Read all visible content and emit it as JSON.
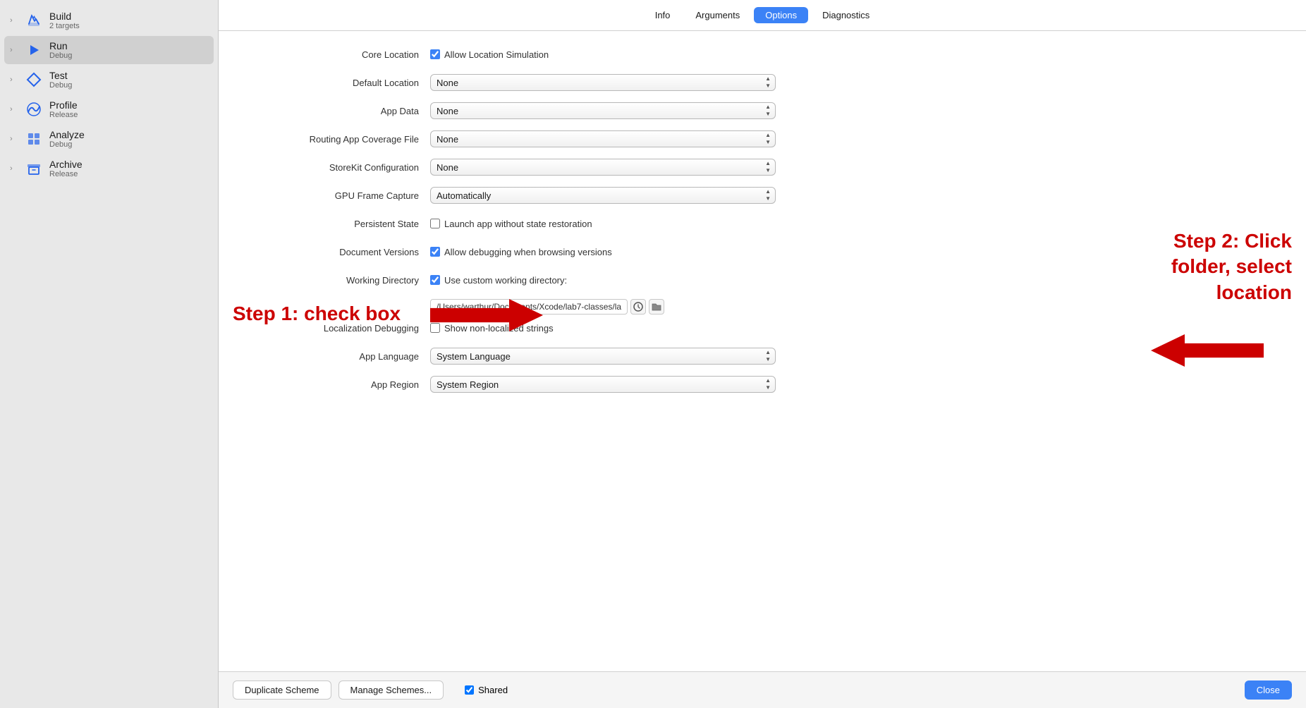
{
  "sidebar": {
    "items": [
      {
        "id": "build",
        "label": "Build",
        "sublabel": "2 targets",
        "icon": "hammer",
        "selected": false
      },
      {
        "id": "run",
        "label": "Run",
        "sublabel": "Debug",
        "icon": "play",
        "selected": true
      },
      {
        "id": "test",
        "label": "Test",
        "sublabel": "Debug",
        "icon": "diamond",
        "selected": false
      },
      {
        "id": "profile",
        "label": "Profile",
        "sublabel": "Release",
        "icon": "wave",
        "selected": false
      },
      {
        "id": "analyze",
        "label": "Analyze",
        "sublabel": "Debug",
        "icon": "grid",
        "selected": false
      },
      {
        "id": "archive",
        "label": "Archive",
        "sublabel": "Release",
        "icon": "box",
        "selected": false
      }
    ]
  },
  "tabs": {
    "items": [
      "Info",
      "Arguments",
      "Options",
      "Diagnostics"
    ],
    "active": "Options"
  },
  "settings": {
    "core_location": {
      "label": "Core Location",
      "checkbox_label": "Allow Location Simulation",
      "checked": true
    },
    "default_location": {
      "label": "Default Location",
      "value": "None"
    },
    "app_data": {
      "label": "App Data",
      "value": "None"
    },
    "routing_app_coverage": {
      "label": "Routing App Coverage File",
      "value": "None"
    },
    "storekit_configuration": {
      "label": "StoreKit Configuration",
      "value": "None"
    },
    "gpu_frame_capture": {
      "label": "GPU Frame Capture",
      "value": "Automatically"
    },
    "persistent_state": {
      "label": "Persistent State",
      "checkbox_label": "Launch app without state restoration",
      "checked": false
    },
    "document_versions": {
      "label": "Document Versions",
      "checkbox_label": "Allow debugging when browsing versions",
      "checked": true
    },
    "working_directory": {
      "label": "Working Directory",
      "checkbox_label": "Use custom working directory:",
      "checked": true,
      "path": "/Users/warthur/Documents/Xcode/lab7-classes/la"
    },
    "localization_debugging": {
      "label": "Localization Debugging",
      "checkbox_label": "Show non-localized strings",
      "checked": false
    },
    "app_language": {
      "label": "App Language",
      "value": "System Language"
    },
    "app_region": {
      "label": "App Region",
      "value": "System Region"
    }
  },
  "bottom_bar": {
    "duplicate_label": "Duplicate Scheme",
    "manage_label": "Manage Schemes...",
    "shared_label": "Shared",
    "shared_checked": true,
    "close_label": "Close"
  },
  "annotations": {
    "step1": "Step 1: check box",
    "step2": "Step 2: Click\nfolder, select\nlocation"
  }
}
